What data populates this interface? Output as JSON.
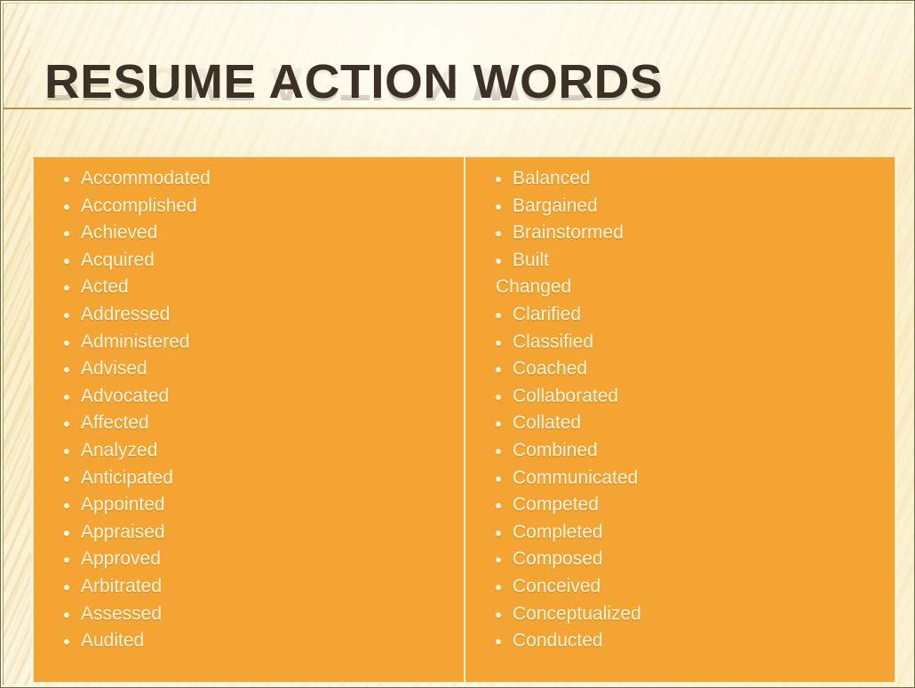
{
  "slide": {
    "title": "RESUME ACTION WORDS",
    "accent_orange": "#F3A433",
    "text_cream": "#FCF6DD",
    "title_color": "#3D3126",
    "background_cream": "#FBF3D4",
    "rule_gold": "#C3A053"
  },
  "columns": [
    {
      "name": "left-column",
      "items": [
        {
          "text": "Accommodated",
          "bulleted": true
        },
        {
          "text": "Accomplished",
          "bulleted": true
        },
        {
          "text": "Achieved",
          "bulleted": true
        },
        {
          "text": "Acquired",
          "bulleted": true
        },
        {
          "text": "Acted",
          "bulleted": true
        },
        {
          "text": "Addressed",
          "bulleted": true
        },
        {
          "text": "Administered",
          "bulleted": true
        },
        {
          "text": "Advised",
          "bulleted": true
        },
        {
          "text": "Advocated",
          "bulleted": true
        },
        {
          "text": "Affected",
          "bulleted": true
        },
        {
          "text": "Analyzed",
          "bulleted": true
        },
        {
          "text": "Anticipated",
          "bulleted": true
        },
        {
          "text": "Appointed",
          "bulleted": true
        },
        {
          "text": "Appraised",
          "bulleted": true
        },
        {
          "text": "Approved",
          "bulleted": true
        },
        {
          "text": "Arbitrated",
          "bulleted": true
        },
        {
          "text": "Assessed",
          "bulleted": true
        },
        {
          "text": "Audited",
          "bulleted": true
        }
      ]
    },
    {
      "name": "right-column",
      "items": [
        {
          "text": "Balanced",
          "bulleted": true
        },
        {
          "text": "Bargained",
          "bulleted": true
        },
        {
          "text": "Brainstormed",
          "bulleted": true
        },
        {
          "text": "Built",
          "bulleted": true
        },
        {
          "text": "Changed",
          "bulleted": false
        },
        {
          "text": "Clarified",
          "bulleted": true
        },
        {
          "text": "Classified",
          "bulleted": true
        },
        {
          "text": "Coached",
          "bulleted": true
        },
        {
          "text": "Collaborated",
          "bulleted": true
        },
        {
          "text": "Collated",
          "bulleted": true
        },
        {
          "text": "Combined",
          "bulleted": true
        },
        {
          "text": "Communicated",
          "bulleted": true
        },
        {
          "text": "Competed",
          "bulleted": true
        },
        {
          "text": "Completed",
          "bulleted": true
        },
        {
          "text": "Composed",
          "bulleted": true
        },
        {
          "text": "Conceived",
          "bulleted": true
        },
        {
          "text": "Conceptualized",
          "bulleted": true
        },
        {
          "text": "Conducted",
          "bulleted": true
        }
      ]
    }
  ]
}
